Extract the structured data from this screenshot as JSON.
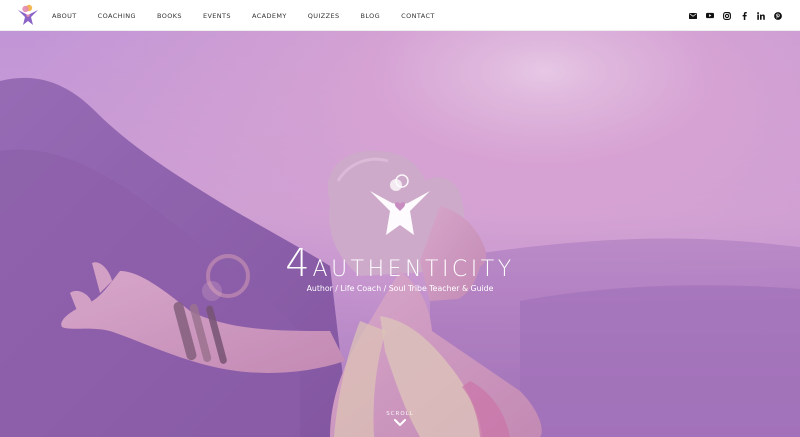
{
  "header": {
    "nav": [
      "ABOUT",
      "COACHING",
      "BOOKS",
      "EVENTS",
      "ACADEMY",
      "QUIZZES",
      "BLOG",
      "CONTACT"
    ],
    "social_icons": [
      "email-icon",
      "youtube-icon",
      "instagram-icon",
      "facebook-icon",
      "linkedin-icon",
      "pinterest-icon"
    ]
  },
  "hero": {
    "brand_digit": "4",
    "brand_word": "AUTHENTICITY",
    "tagline": "Author / Life Coach / Soul Tribe Teacher & Guide",
    "scroll_label": "SCROLL"
  },
  "colors": {
    "overlay_purple": "#b98ad0",
    "overlay_pink": "#e7a6c6",
    "logo_purple": "#8b63c6",
    "logo_pink": "#e38bb3",
    "logo_gold": "#f2b44b"
  }
}
